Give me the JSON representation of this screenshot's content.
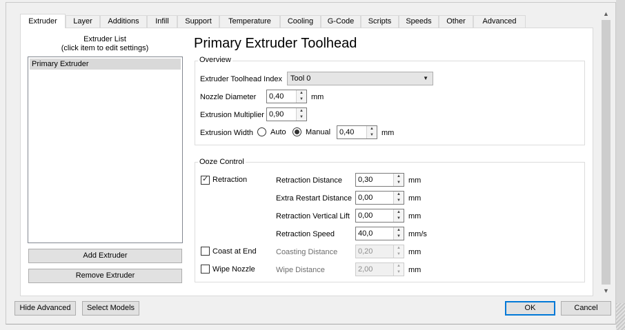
{
  "tabs": [
    "Extruder",
    "Layer",
    "Additions",
    "Infill",
    "Support",
    "Temperature",
    "Cooling",
    "G-Code",
    "Scripts",
    "Speeds",
    "Other",
    "Advanced"
  ],
  "extruder_list": {
    "title_line1": "Extruder List",
    "title_line2": "(click item to edit settings)",
    "items": [
      "Primary Extruder"
    ],
    "add_button": "Add Extruder",
    "remove_button": "Remove Extruder"
  },
  "heading": "Primary Extruder Toolhead",
  "overview": {
    "label": "Overview",
    "toolhead_index_label": "Extruder Toolhead Index",
    "toolhead_index_value": "Tool 0",
    "nozzle_label": "Nozzle Diameter",
    "nozzle_value": "0,40",
    "nozzle_unit": "mm",
    "multiplier_label": "Extrusion Multiplier",
    "multiplier_value": "0,90",
    "width_label": "Extrusion Width",
    "width_auto": "Auto",
    "width_manual": "Manual",
    "width_value": "0,40",
    "width_unit": "mm"
  },
  "ooze": {
    "label": "Ooze Control",
    "retraction_label": "Retraction",
    "retraction_checked": true,
    "retraction_distance_label": "Retraction Distance",
    "retraction_distance_value": "0,30",
    "retraction_distance_unit": "mm",
    "extra_restart_label": "Extra Restart Distance",
    "extra_restart_value": "0,00",
    "extra_restart_unit": "mm",
    "vertical_lift_label": "Retraction Vertical Lift",
    "vertical_lift_value": "0,00",
    "vertical_lift_unit": "mm",
    "retraction_speed_label": "Retraction Speed",
    "retraction_speed_value": "40,0",
    "retraction_speed_unit": "mm/s",
    "coast_label": "Coast at End",
    "coast_checked": false,
    "coasting_distance_label": "Coasting Distance",
    "coasting_distance_value": "0,20",
    "coasting_distance_unit": "mm",
    "wipe_label": "Wipe Nozzle",
    "wipe_checked": false,
    "wipe_distance_label": "Wipe Distance",
    "wipe_distance_value": "2,00",
    "wipe_distance_unit": "mm"
  },
  "footer": {
    "hide_advanced": "Hide Advanced",
    "select_models": "Select Models",
    "ok": "OK",
    "cancel": "Cancel"
  },
  "icons": {
    "scroll_up": "chevron-up-icon",
    "scroll_down": "chevron-down-icon",
    "checkmark": "checkmark-icon",
    "spin_up": "triangle-up-icon",
    "spin_down": "triangle-down-icon",
    "dropdown": "triangle-down-icon"
  },
  "colors": {
    "accent": "#0078d7",
    "panel_bg": "#ffffff",
    "window_bg": "#f0f0f0",
    "selection": "#d9d9d9"
  }
}
